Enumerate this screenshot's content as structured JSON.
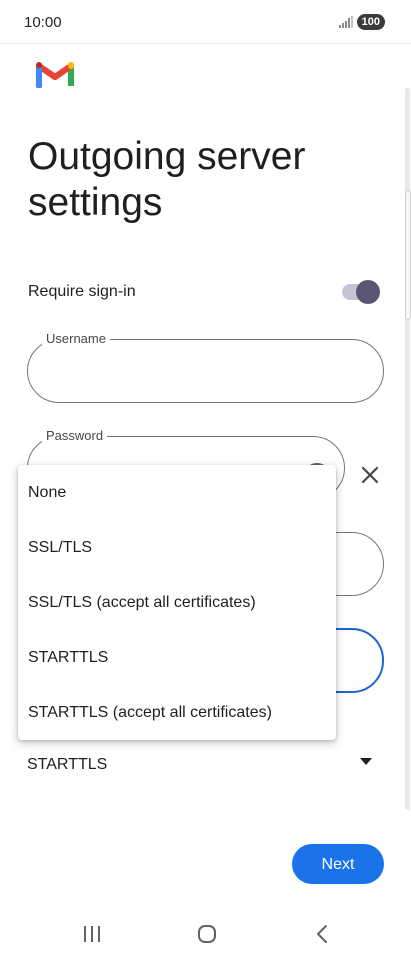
{
  "status_bar": {
    "time": "10:00",
    "battery": "100"
  },
  "header": {
    "title": "Outgoing server settings"
  },
  "require_signin": {
    "label": "Require sign-in",
    "enabled": true
  },
  "username": {
    "label": "Username",
    "value": ""
  },
  "password": {
    "label": "Password",
    "value": ""
  },
  "security": {
    "selected": "STARTTLS"
  },
  "dropdown": {
    "options": [
      "None",
      "SSL/TLS",
      "SSL/TLS (accept all certificates)",
      "STARTTLS",
      "STARTTLS (accept all certificates)"
    ]
  },
  "actions": {
    "next_label": "Next"
  },
  "colors": {
    "accent": "#1a73e8",
    "toggle": "#5b5474"
  },
  "icons": {
    "logo": "gmail-logo",
    "password_toggle": "eye-icon",
    "clear": "close-icon",
    "dropdown": "chevron-down-icon"
  }
}
